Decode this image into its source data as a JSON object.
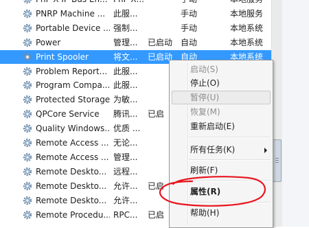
{
  "services": [
    {
      "name": "PnP-X IP Bus En...",
      "desc": "PnP-X...",
      "status": "",
      "startup": "手动",
      "logon": "本地服务"
    },
    {
      "name": "PNRP Machine ...",
      "desc": "此服...",
      "status": "",
      "startup": "手动",
      "logon": "本地服务"
    },
    {
      "name": "Portable Device ...",
      "desc": "强制...",
      "status": "",
      "startup": "手动",
      "logon": "本地系统"
    },
    {
      "name": "Power",
      "desc": "管理...",
      "status": "已启动",
      "startup": "自动",
      "logon": "本地系统"
    },
    {
      "name": "Print Spooler",
      "desc": "将文...",
      "status": "已启动",
      "startup": "自动",
      "logon": "本地系统"
    },
    {
      "name": "Problem Report...",
      "desc": "此服...",
      "status": "",
      "startup": "",
      "logon": ""
    },
    {
      "name": "Program Compa...",
      "desc": "此服...",
      "status": "",
      "startup": "",
      "logon": ""
    },
    {
      "name": "Protected Storage",
      "desc": "为敏...",
      "status": "",
      "startup": "",
      "logon": ""
    },
    {
      "name": "QPCore Service",
      "desc": "腾讯...",
      "status": "已启",
      "startup": "",
      "logon": ""
    },
    {
      "name": "Quality Windows...",
      "desc": "优质 ...",
      "status": "",
      "startup": "",
      "logon": ""
    },
    {
      "name": "Remote Access ...",
      "desc": "无论...",
      "status": "",
      "startup": "",
      "logon": ""
    },
    {
      "name": "Remote Access ...",
      "desc": "管理...",
      "status": "",
      "startup": "",
      "logon": ""
    },
    {
      "name": "Remote Deskto...",
      "desc": "远程...",
      "status": "",
      "startup": "",
      "logon": ""
    },
    {
      "name": "Remote Deskto...",
      "desc": "允许...",
      "status": "已启",
      "startup": "",
      "logon": ""
    },
    {
      "name": "Remote Deskto...",
      "desc": "允许...",
      "status": "",
      "startup": "",
      "logon": ""
    },
    {
      "name": "Remote Procedu...",
      "desc": "RPC...",
      "status": "已启",
      "startup": "",
      "logon": ""
    }
  ],
  "selected_index": 4,
  "context_menu": {
    "items": [
      {
        "label": "启动(S)",
        "disabled": true
      },
      {
        "label": "停止(O)",
        "disabled": false
      },
      {
        "label": "暂停(U)",
        "disabled": true
      },
      {
        "label": "恢复(M)",
        "disabled": true
      },
      {
        "label": "重新启动(E)",
        "disabled": false
      },
      {
        "label": "所有任务(K)",
        "disabled": false,
        "submenu": true
      },
      {
        "label": "刷新(F)",
        "disabled": false
      },
      {
        "label": "属性(R)",
        "disabled": false,
        "bold": true
      },
      {
        "label": "帮助(H)",
        "disabled": false
      }
    ]
  },
  "colors": {
    "selection": "#3399ff",
    "annotation": "#e8141e",
    "gear": "#6a8cad"
  },
  "icons": [
    "gear-icon",
    "submenu-arrow-icon"
  ]
}
